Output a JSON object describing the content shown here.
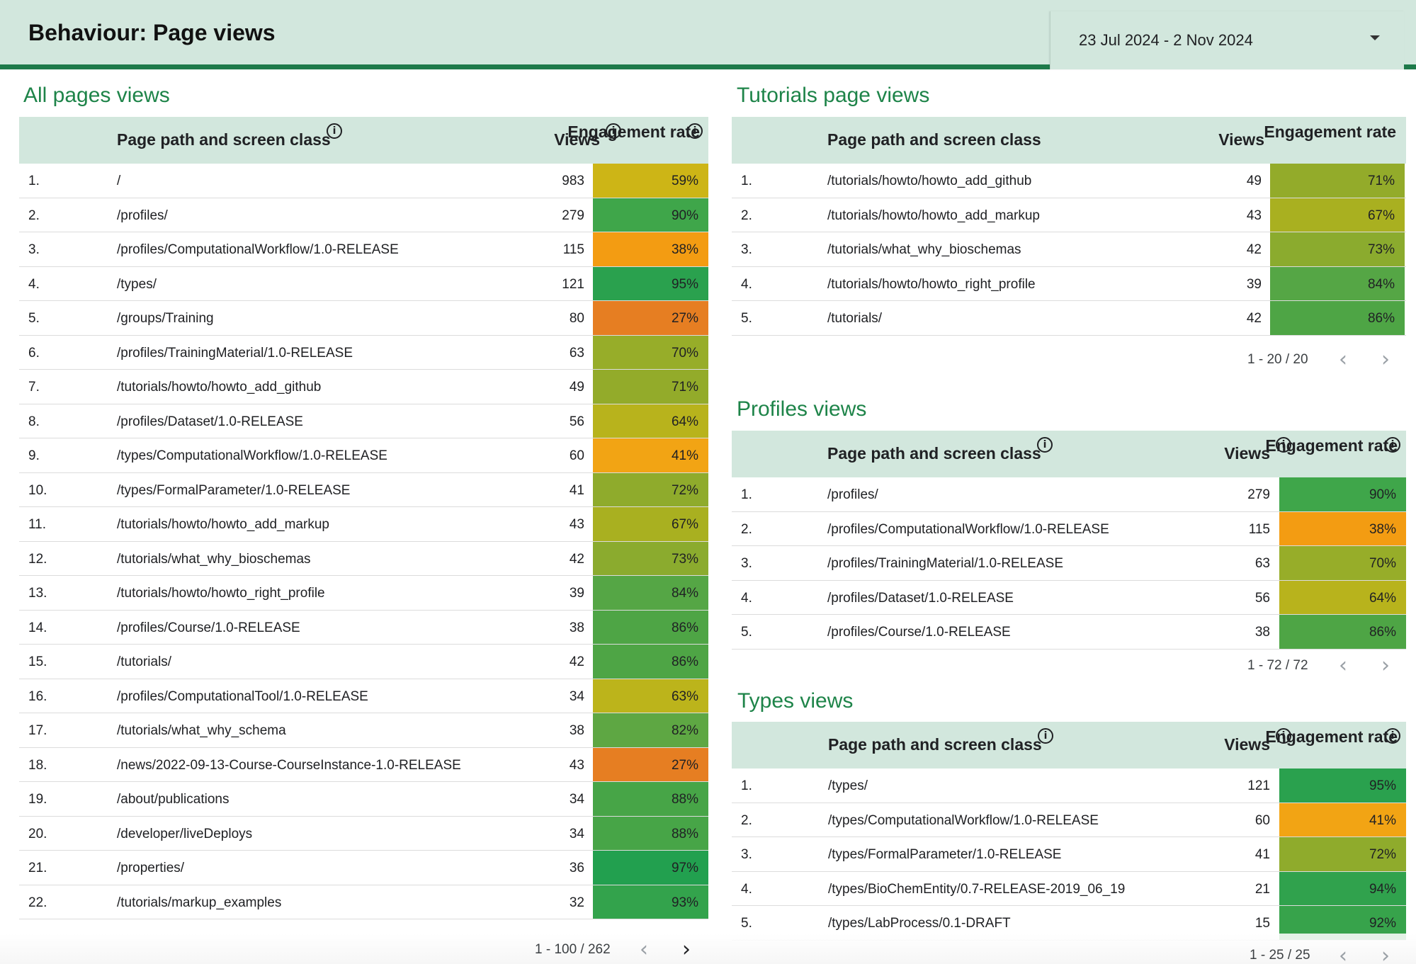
{
  "header": {
    "title": "Behaviour: Page views",
    "date_range": "23 Jul 2024 - 2 Nov 2024"
  },
  "colors": {
    "header_bg": "#d2e7dd",
    "accent": "#1e7a4a",
    "section_title": "#1e8449"
  },
  "icons": {
    "info": "info-icon",
    "dropdown": "caret-down-icon",
    "prev": "chevron-left-icon",
    "next": "chevron-right-icon"
  },
  "all_pages": {
    "title": "All pages views",
    "col_path": "Page path and screen class",
    "col_views": "Views",
    "col_rate": "Engagement rate",
    "pager": "1 - 100 / 262",
    "rows": [
      {
        "idx": "1.",
        "path": "/",
        "views": "983",
        "rate": "59%",
        "color": "#cdb516"
      },
      {
        "idx": "2.",
        "path": "/profiles/",
        "views": "279",
        "rate": "90%",
        "color": "#3fa64a"
      },
      {
        "idx": "3.",
        "path": "/profiles/ComputationalWorkflow/1.0-RELEASE",
        "views": "115",
        "rate": "38%",
        "color": "#f39c12"
      },
      {
        "idx": "4.",
        "path": "/types/",
        "views": "121",
        "rate": "95%",
        "color": "#2aa14e"
      },
      {
        "idx": "5.",
        "path": "/groups/Training",
        "views": "80",
        "rate": "27%",
        "color": "#e67e22"
      },
      {
        "idx": "6.",
        "path": "/profiles/TrainingMaterial/1.0-RELEASE",
        "views": "63",
        "rate": "70%",
        "color": "#97ad29"
      },
      {
        "idx": "7.",
        "path": "/tutorials/howto/howto_add_github",
        "views": "49",
        "rate": "71%",
        "color": "#93ab2a"
      },
      {
        "idx": "8.",
        "path": "/profiles/Dataset/1.0-RELEASE",
        "views": "56",
        "rate": "64%",
        "color": "#b8b31c"
      },
      {
        "idx": "9.",
        "path": "/types/ComputationalWorkflow/1.0-RELEASE",
        "views": "60",
        "rate": "41%",
        "color": "#f2a414"
      },
      {
        "idx": "10.",
        "path": "/types/FormalParameter/1.0-RELEASE",
        "views": "41",
        "rate": "72%",
        "color": "#8fab2c"
      },
      {
        "idx": "11.",
        "path": "/tutorials/howto/howto_add_markup",
        "views": "43",
        "rate": "67%",
        "color": "#a9b020"
      },
      {
        "idx": "12.",
        "path": "/tutorials/what_why_bioschemas",
        "views": "42",
        "rate": "73%",
        "color": "#8bab2e"
      },
      {
        "idx": "13.",
        "path": "/tutorials/howto/howto_right_profile",
        "views": "39",
        "rate": "84%",
        "color": "#55a645"
      },
      {
        "idx": "14.",
        "path": "/profiles/Course/1.0-RELEASE",
        "views": "38",
        "rate": "86%",
        "color": "#4ea545"
      },
      {
        "idx": "15.",
        "path": "/tutorials/",
        "views": "42",
        "rate": "86%",
        "color": "#4ea545"
      },
      {
        "idx": "16.",
        "path": "/profiles/ComputationalTool/1.0-RELEASE",
        "views": "34",
        "rate": "63%",
        "color": "#bcb41b"
      },
      {
        "idx": "17.",
        "path": "/tutorials/what_why_schema",
        "views": "38",
        "rate": "82%",
        "color": "#5ea743"
      },
      {
        "idx": "18.",
        "path": "/news/2022-09-13-Course-CourseInstance-1.0-RELEASE",
        "views": "43",
        "rate": "27%",
        "color": "#e67e22"
      },
      {
        "idx": "19.",
        "path": "/about/publications",
        "views": "34",
        "rate": "88%",
        "color": "#47a547"
      },
      {
        "idx": "20.",
        "path": "/developer/liveDeploys",
        "views": "34",
        "rate": "88%",
        "color": "#47a547"
      },
      {
        "idx": "21.",
        "path": "/properties/",
        "views": "36",
        "rate": "97%",
        "color": "#22a04f"
      },
      {
        "idx": "22.",
        "path": "/tutorials/markup_examples",
        "views": "32",
        "rate": "93%",
        "color": "#33a34c"
      }
    ]
  },
  "tutorials": {
    "title": "Tutorials page views",
    "col_path": "Page path and screen class",
    "col_views": "Views",
    "col_rate": "Engagement rate",
    "pager": "1 - 20 / 20",
    "rows": [
      {
        "idx": "1.",
        "path": "/tutorials/howto/howto_add_github",
        "views": "49",
        "rate": "71%",
        "color": "#93ab2a"
      },
      {
        "idx": "2.",
        "path": "/tutorials/howto/howto_add_markup",
        "views": "43",
        "rate": "67%",
        "color": "#a9b020"
      },
      {
        "idx": "3.",
        "path": "/tutorials/what_why_bioschemas",
        "views": "42",
        "rate": "73%",
        "color": "#8bab2e"
      },
      {
        "idx": "4.",
        "path": "/tutorials/howto/howto_right_profile",
        "views": "39",
        "rate": "84%",
        "color": "#55a645"
      },
      {
        "idx": "5.",
        "path": "/tutorials/",
        "views": "42",
        "rate": "86%",
        "color": "#4ea545"
      }
    ]
  },
  "profiles": {
    "title": "Profiles views",
    "col_path": "Page path and screen class",
    "col_views": "Views",
    "col_rate": "Engagement rate",
    "pager": "1 - 72 / 72",
    "rows": [
      {
        "idx": "1.",
        "path": "/profiles/",
        "views": "279",
        "rate": "90%",
        "color": "#3fa64a"
      },
      {
        "idx": "2.",
        "path": "/profiles/ComputationalWorkflow/1.0-RELEASE",
        "views": "115",
        "rate": "38%",
        "color": "#f39c12"
      },
      {
        "idx": "3.",
        "path": "/profiles/TrainingMaterial/1.0-RELEASE",
        "views": "63",
        "rate": "70%",
        "color": "#97ad29"
      },
      {
        "idx": "4.",
        "path": "/profiles/Dataset/1.0-RELEASE",
        "views": "56",
        "rate": "64%",
        "color": "#b8b31c"
      },
      {
        "idx": "5.",
        "path": "/profiles/Course/1.0-RELEASE",
        "views": "38",
        "rate": "86%",
        "color": "#4ea545"
      }
    ]
  },
  "types": {
    "title": "Types views",
    "col_path": "Page path and screen class",
    "col_views": "Views",
    "col_rate": "Engagement rate",
    "pager": "1 - 25 / 25",
    "rows": [
      {
        "idx": "1.",
        "path": "/types/",
        "views": "121",
        "rate": "95%",
        "color": "#2aa14e"
      },
      {
        "idx": "2.",
        "path": "/types/ComputationalWorkflow/1.0-RELEASE",
        "views": "60",
        "rate": "41%",
        "color": "#f2a414"
      },
      {
        "idx": "3.",
        "path": "/types/FormalParameter/1.0-RELEASE",
        "views": "41",
        "rate": "72%",
        "color": "#8fab2c"
      },
      {
        "idx": "4.",
        "path": "/types/BioChemEntity/0.7-RELEASE-2019_06_19",
        "views": "21",
        "rate": "94%",
        "color": "#30a24d"
      },
      {
        "idx": "5.",
        "path": "/types/LabProcess/0.1-DRAFT",
        "views": "15",
        "rate": "92%",
        "color": "#37a34b"
      }
    ]
  }
}
